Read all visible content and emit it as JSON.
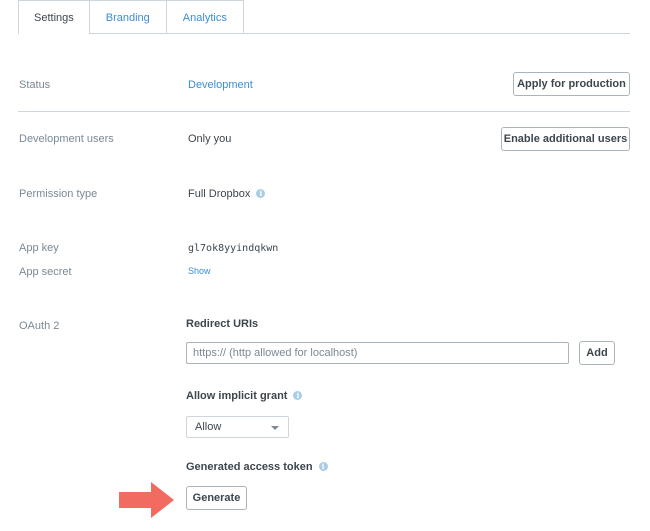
{
  "tabs": [
    {
      "label": "Settings",
      "active": true
    },
    {
      "label": "Branding",
      "active": false
    },
    {
      "label": "Analytics",
      "active": false
    }
  ],
  "status": {
    "label": "Status",
    "value": "Development",
    "button": "Apply for production"
  },
  "dev_users": {
    "label": "Development users",
    "value": "Only you",
    "button": "Enable additional users"
  },
  "permission": {
    "label": "Permission type",
    "value": "Full Dropbox",
    "icon": "info-icon"
  },
  "app_key": {
    "label": "App key",
    "value": "gl7ok8yyindqkwn"
  },
  "app_secret": {
    "label": "App secret",
    "value": "Show"
  },
  "oauth": {
    "label": "OAuth 2",
    "redirect": {
      "heading": "Redirect URIs",
      "placeholder": "https:// (http allowed for localhost)",
      "value": "",
      "button": "Add"
    },
    "implicit": {
      "heading": "Allow implicit grant",
      "selected": "Allow",
      "icon": "info-icon"
    },
    "token": {
      "heading": "Generated access token",
      "button": "Generate",
      "icon": "info-icon"
    }
  },
  "colors": {
    "accent": "#3b8dd6",
    "arrow": "#f26b61",
    "border": "#cfd6db"
  }
}
